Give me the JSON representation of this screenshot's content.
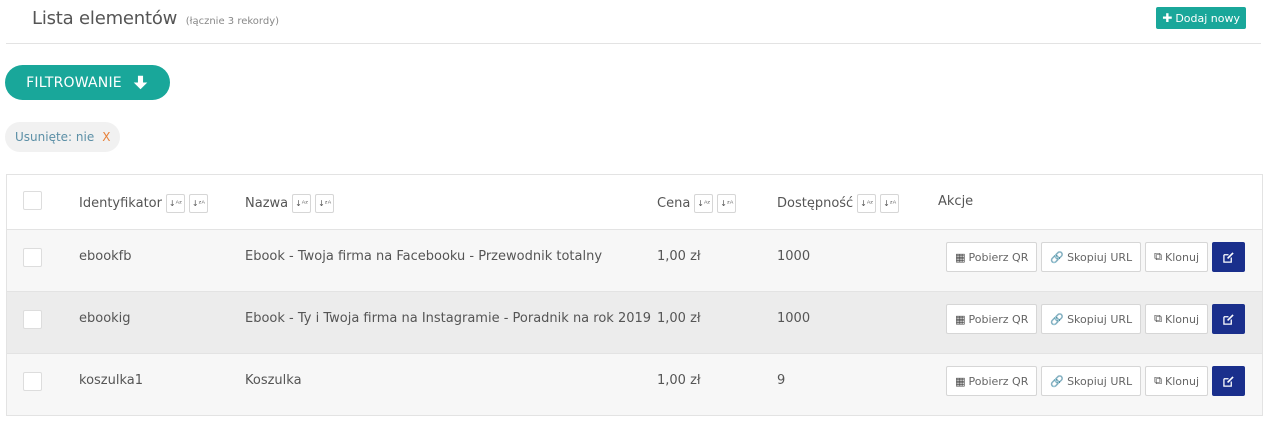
{
  "header": {
    "title": "Lista elementów",
    "count": "(łącznie 3 rekordy)",
    "add_label": "Dodaj nowy"
  },
  "filter": {
    "label": "FILTROWANIE",
    "chip_label": "Usunięte: nie",
    "chip_close": "X"
  },
  "table": {
    "columns": [
      "Identyfikator",
      "Nazwa",
      "Cena",
      "Dostępność",
      "Akcje"
    ],
    "rows": [
      {
        "id": "ebookfb",
        "name": "Ebook - Twoja firma na Facebooku - Przewodnik totalny",
        "price": "1,00 zł",
        "availability": "1000"
      },
      {
        "id": "ebookig",
        "name": "Ebook - Ty i Twoja firma na Instagramie - Poradnik na rok 2019",
        "price": "1,00 zł",
        "availability": "1000"
      },
      {
        "id": "koszulka1",
        "name": "Koszulka",
        "price": "1,00 zł",
        "availability": "9"
      }
    ],
    "actions": {
      "qr": "Pobierz QR",
      "copy_url": "Skopiuj URL",
      "clone": "Klonuj"
    },
    "sort_asc": "↓A Z",
    "sort_desc": "↓Z A"
  },
  "colors": {
    "accent": "#19a79a",
    "edit": "#1a2f8c",
    "chip_close": "#e8813a"
  },
  "icons": {
    "add": "plus-icon",
    "filter": "arrow-down-icon",
    "qr": "qr-icon",
    "copy": "link-icon",
    "clone": "clone-icon",
    "edit": "edit-icon"
  }
}
